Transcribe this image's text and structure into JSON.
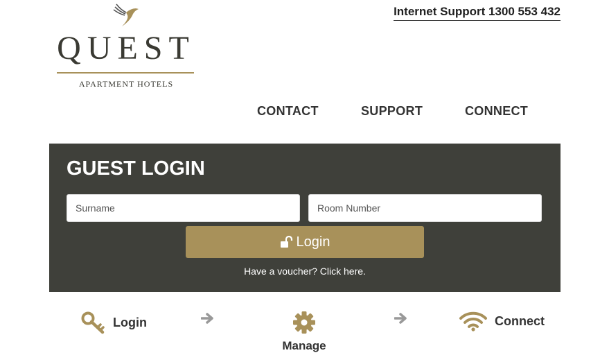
{
  "header": {
    "logo_text": "QUEST",
    "logo_subtitle": "APARTMENT HOTELS",
    "support_link": "Internet Support 1300 553 432"
  },
  "nav": [
    {
      "label": "CONTACT"
    },
    {
      "label": "SUPPORT"
    },
    {
      "label": "CONNECT"
    }
  ],
  "login_panel": {
    "title": "GUEST LOGIN",
    "surname_placeholder": "Surname",
    "room_placeholder": "Room Number",
    "login_label": "Login",
    "voucher_text": "Have a voucher? Click here."
  },
  "steps": [
    {
      "label": "Login",
      "icon": "key-icon"
    },
    {
      "label": "Manage",
      "icon": "gear-icon"
    },
    {
      "label": "Connect",
      "icon": "wifi-icon"
    }
  ],
  "colors": {
    "accent": "#a8915a",
    "panel": "#3f403a",
    "text": "#333333"
  }
}
